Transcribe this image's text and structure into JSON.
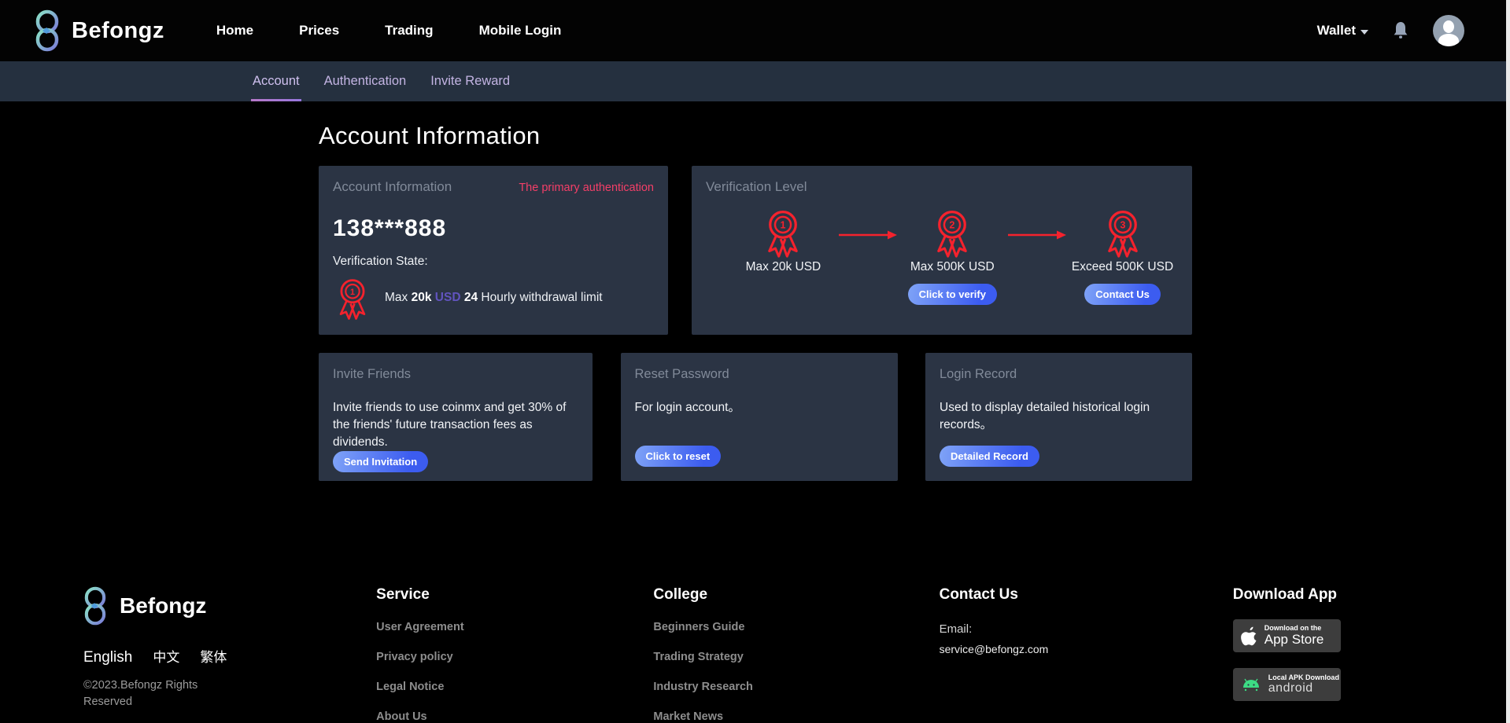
{
  "header": {
    "brand": "Befongz",
    "nav": [
      "Home",
      "Prices",
      "Trading",
      "Mobile Login"
    ],
    "wallet_label": "Wallet"
  },
  "subnav": {
    "tabs": [
      {
        "label": "Account",
        "active": true
      },
      {
        "label": "Authentication",
        "active": false
      },
      {
        "label": "Invite Reward",
        "active": false
      }
    ]
  },
  "page": {
    "title": "Account Information"
  },
  "cards": {
    "account": {
      "title": "Account Information",
      "badge": "The primary authentication",
      "phone": "138***888",
      "state_label": "Verification State:",
      "medal_number": "1",
      "limit": {
        "prefix": "Max",
        "amount": "20k",
        "currency": "USD",
        "hours": "24",
        "suffix": "Hourly withdrawal limit"
      }
    },
    "verification": {
      "title": "Verification Level",
      "steps": [
        {
          "number": "1",
          "label": "Max 20k USD",
          "button": ""
        },
        {
          "number": "2",
          "label": "Max 500K USD",
          "button": "Click to verify"
        },
        {
          "number": "3",
          "label": "Exceed 500K USD",
          "button": "Contact Us"
        }
      ]
    },
    "invite": {
      "title": "Invite Friends",
      "body": "Invite friends to use coinmx and get 30% of the friends' future transaction fees as dividends.",
      "button": "Send Invitation"
    },
    "reset": {
      "title": "Reset Password",
      "body": "For login account。",
      "button": "Click to reset"
    },
    "login_record": {
      "title": "Login Record",
      "body": "Used to display detailed historical login records。",
      "button": "Detailed Record"
    }
  },
  "footer": {
    "brand": "Befongz",
    "languages": [
      "English",
      "中文",
      "繁体"
    ],
    "copyright": "©2023.Befongz Rights Reserved",
    "columns": [
      {
        "title": "Service",
        "links": [
          "User Agreement",
          "Privacy policy",
          "Legal Notice",
          "About Us"
        ]
      },
      {
        "title": "College",
        "links": [
          "Beginners Guide",
          "Trading Strategy",
          "Industry Research",
          "Market News"
        ]
      }
    ],
    "contact": {
      "title": "Contact Us",
      "email_label": "Email:",
      "email": "service@befongz.com"
    },
    "download": {
      "title": "Download App",
      "apple": {
        "line1": "Download on the",
        "line2": "App Store"
      },
      "android": {
        "line1": "Local APK Download",
        "line2": "android"
      }
    }
  },
  "colors": {
    "accent_pink": "#f43f68",
    "medal_red": "#f5222d",
    "button_blue_start": "#7fa3f7",
    "button_blue_end": "#3c5cf0",
    "subnav_bg": "#25303f",
    "card_bg": "#2b3444",
    "tab_lavender": "#c3b4e3",
    "usd_purple": "#6154be"
  }
}
